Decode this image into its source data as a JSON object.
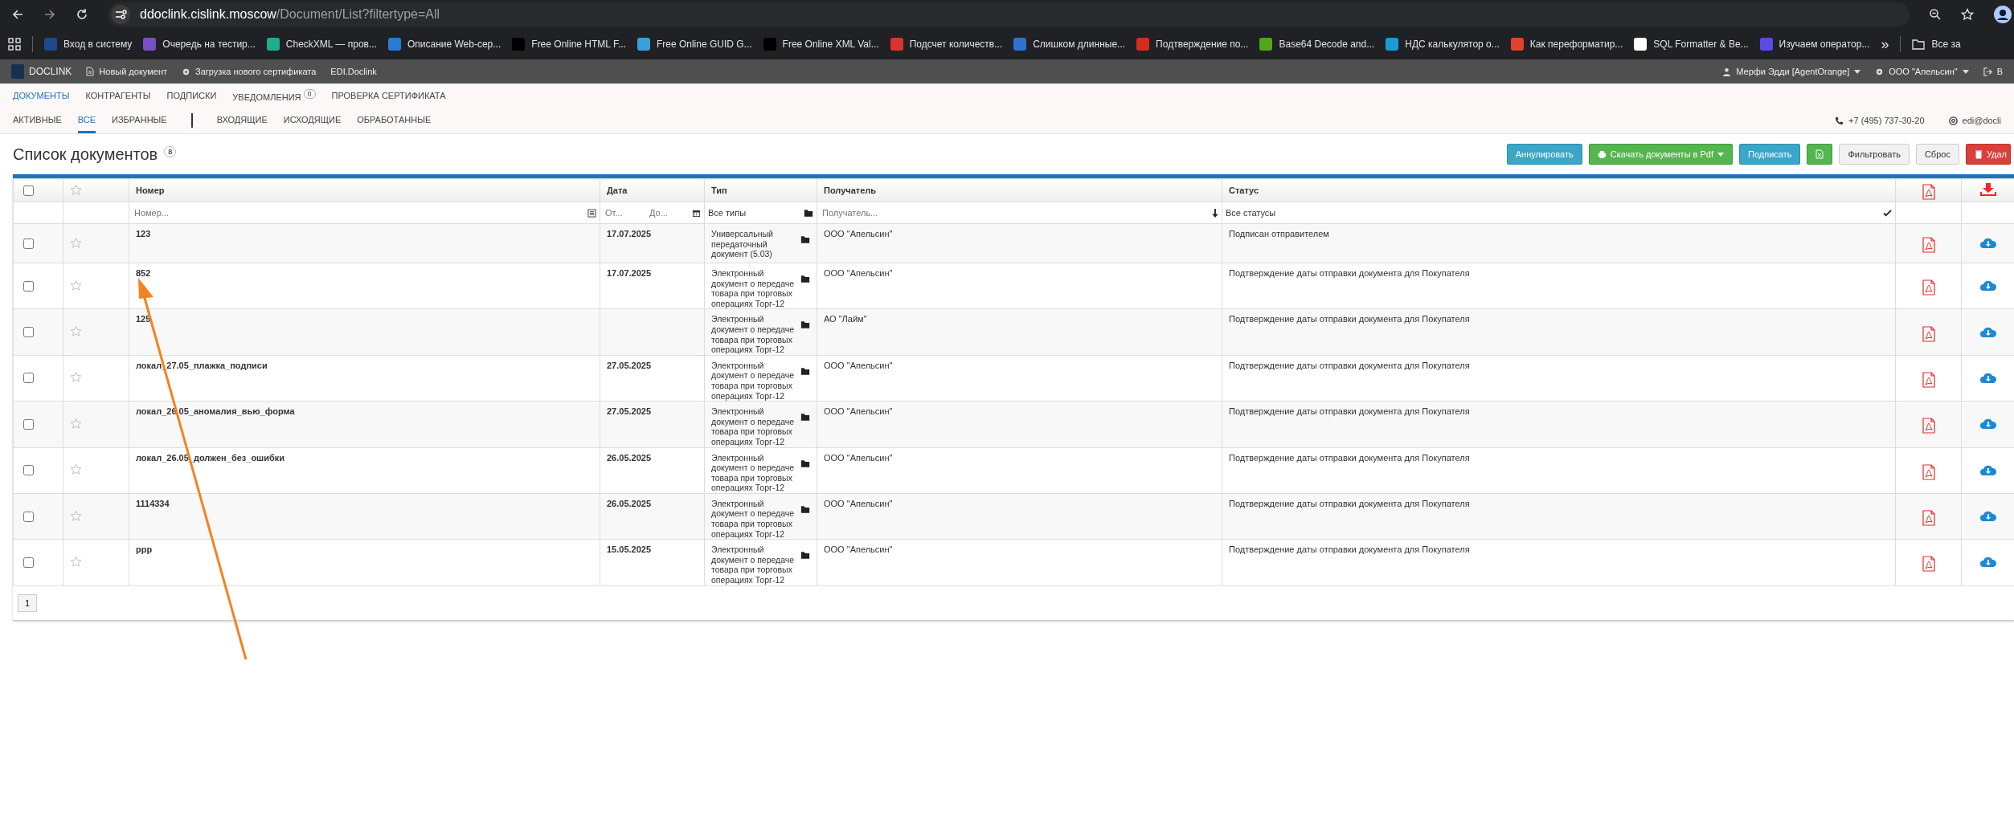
{
  "browser": {
    "url_host": "ddoclink.cislink.moscow",
    "url_path": "/Document/List?filtertype=All",
    "bookmarks": [
      {
        "label": "Вход в систему",
        "color": "#1a4b8c"
      },
      {
        "label": "Очередь на тестир...",
        "color": "#7b4fc4"
      },
      {
        "label": "CheckXML — пров...",
        "color": "#1fae8c"
      },
      {
        "label": "Описание Web-сер...",
        "color": "#2a7ad8"
      },
      {
        "label": "Free Online HTML F...",
        "color": "#000000"
      },
      {
        "label": "Free Online GUID G...",
        "color": "#3aa0d8"
      },
      {
        "label": "Free Online XML Val...",
        "color": "#000000"
      },
      {
        "label": "Подсчет количеств...",
        "color": "#d9362b"
      },
      {
        "label": "Слишком длинные...",
        "color": "#2f6fd0"
      },
      {
        "label": "Подтверждение по...",
        "color": "#d52b1e"
      },
      {
        "label": "Base64 Decode and...",
        "color": "#4fa81c"
      },
      {
        "label": "НДС калькулятор о...",
        "color": "#1c9ad6"
      },
      {
        "label": "Как переформатир...",
        "color": "#e0442c"
      },
      {
        "label": "SQL Formatter & Be...",
        "color": "#ffffff"
      },
      {
        "label": "Изучаем оператор...",
        "color": "#5b4be6"
      }
    ],
    "more": "»",
    "other_bookmarks": "Все за"
  },
  "app_header": {
    "brand": "DOCLINK",
    "links": [
      "Новый документ",
      "Загрузка нового сертификата",
      "EDI.Doclink"
    ],
    "user": "Мерфи Эдди [AgentOrange]",
    "org": "ООО \"Апельсин\"",
    "exit": "В"
  },
  "nav": [
    {
      "label": "ДОКУМЕНТЫ",
      "selected": true
    },
    {
      "label": "КОНТРАГЕНТЫ",
      "selected": false
    },
    {
      "label": "ПОДПИСКИ",
      "selected": false
    },
    {
      "label": "УВЕДОМЛЕНИЯ",
      "selected": false,
      "badge": "0"
    },
    {
      "label": "ПРОВЕРКА СЕРТИФИКАТА",
      "selected": false
    }
  ],
  "filter_tabs": [
    {
      "label": "АКТИВНЫЕ",
      "selected": false
    },
    {
      "label": "ВСЕ",
      "selected": true
    },
    {
      "label": "ИЗБРАННЫЕ",
      "selected": false
    }
  ],
  "direction_tabs": [
    {
      "label": "ВХОДЯЩИЕ",
      "selected": false
    },
    {
      "label": "ИСХОДЯЩИЕ",
      "selected": false
    },
    {
      "label": "ОБРАБОТАННЫЕ",
      "selected": false
    }
  ],
  "contacts": {
    "phone": "+7 (495) 737-30-20",
    "email": "edi@docli"
  },
  "page_title": "Список документов",
  "count": "8",
  "toolbar": [
    {
      "label": "Аннулировать",
      "kind": "info"
    },
    {
      "label": "Скачать документы в Pdf",
      "kind": "success"
    },
    {
      "label": "Подписать",
      "kind": "info"
    },
    {
      "kind": "excel"
    },
    {
      "label": "Фильтровать",
      "kind": "default"
    },
    {
      "label": "Сброс",
      "kind": "default"
    },
    {
      "label": "Удал",
      "kind": "danger"
    }
  ],
  "table": {
    "columns": [
      "Номер",
      "Дата",
      "Тип",
      "Получатель",
      "Статус"
    ],
    "filters": {
      "number_placeholder": "Номер...",
      "date_from_placeholder": "От...",
      "date_to_placeholder": "До...",
      "type": "Все типы",
      "recipient_placeholder": "Получатель...",
      "status": "Все статусы"
    },
    "header_checked": false,
    "rows": [
      {
        "checked": false,
        "starred": false,
        "number": "123",
        "date": "17.07.2025",
        "type": "Универсальный передаточный документ (5.03)",
        "recipient": "ООО \"Апельсин\"",
        "status": "Подписан отправителем"
      },
      {
        "checked": false,
        "starred": false,
        "number": "852",
        "date": "17.07.2025",
        "type": "Электронный документ о передаче товара при торговых операциях Торг-12",
        "recipient": "ООО \"Апельсин\"",
        "status": "Подтверждение даты отправки документа для Покупателя"
      },
      {
        "checked": false,
        "starred": false,
        "number": "125",
        "type": "Электронный документ о передаче товара при торговых операциях Торг-12",
        "recipient": "АО \"Лайм\"",
        "status": "Подтверждение даты отправки документа для Покупателя"
      },
      {
        "checked": false,
        "starred": false,
        "number": "локал_27.05_плажка_подписи",
        "date": "27.05.2025",
        "type": "Электронный документ о передаче товара при торговых операциях Торг-12",
        "recipient": "ООО \"Апельсин\"",
        "status": "Подтверждение даты отправки документа для Покупателя"
      },
      {
        "checked": false,
        "starred": false,
        "number": "локал_26.05_аномалия_вью_форма",
        "date": "27.05.2025",
        "type": "Электронный документ о передаче товара при торговых операциях Торг-12",
        "recipient": "ООО \"Апельсин\"",
        "status": "Подтверждение даты отправки документа для Покупателя"
      },
      {
        "checked": false,
        "starred": false,
        "number": "локал_26.05_должен_без_ошибки",
        "date": "26.05.2025",
        "type": "Электронный документ о передаче товара при торговых операциях Торг-12",
        "recipient": "ООО \"Апельсин\"",
        "status": "Подтверждение даты отправки документа для Покупателя"
      },
      {
        "checked": false,
        "starred": false,
        "number": "1114334",
        "date": "26.05.2025",
        "type": "Электронный документ о передаче товара при торговых операциях Торг-12",
        "recipient": "ООО \"Апельсин\"",
        "status": "Подтверждение даты отправки документа для Покупателя"
      },
      {
        "checked": false,
        "starred": false,
        "number": "ррр",
        "date": "15.05.2025",
        "type": "Электронный документ о передаче товара при торговых операциях Торг-12",
        "recipient": "ООО \"Апельсин\"",
        "status": "Подтверждение даты отправки документа для Покупателя"
      }
    ]
  },
  "pagination": [
    {
      "label": "1",
      "selected": false
    }
  ]
}
